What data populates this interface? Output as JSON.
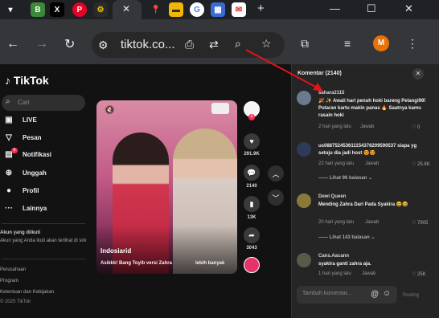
{
  "browser": {
    "url": "tiktok.co...",
    "profile_initial": "M",
    "tab_icons": [
      "B",
      "X",
      "P",
      "gear-icon",
      "maps-icon",
      "card-icon",
      "G",
      "calendar-icon",
      "gmail-icon"
    ],
    "new_tab": "+",
    "window_controls": [
      "—",
      "☐",
      "✕"
    ]
  },
  "tiktok": {
    "logo": "TikTok",
    "search_placeholder": "Cari",
    "nav": [
      {
        "label": "LIVE",
        "icon": "live-icon"
      },
      {
        "label": "Pesan",
        "icon": "messages-icon"
      },
      {
        "label": "Notifikasi",
        "icon": "notifications-icon",
        "badge": "6"
      },
      {
        "label": "Unggah",
        "icon": "upload-icon"
      },
      {
        "label": "Profil",
        "icon": "profile-icon"
      },
      {
        "label": "Lainnya",
        "icon": "more-icon"
      }
    ],
    "following_heading": "Akun yang diikuti",
    "following_note": "Akun yang Anda ikuti akan terlihat di sini",
    "footer_links": [
      "Perusahaan",
      "Program",
      "Ketentuan dan Kebijakan"
    ],
    "copyright": "© 2025 TikTok"
  },
  "video": {
    "author": "Indosiarid",
    "caption": "Asikkk! Bang Toyib versi Zahra",
    "more": "lebih banyak",
    "likes": "291.9K",
    "comments": "2140",
    "saves": "13K",
    "shares": "3043"
  },
  "comments_panel": {
    "title": "Komentar (2140)",
    "input_placeholder": "Tambah komentar...",
    "post_label": "Posting",
    "items": [
      {
        "user": "sahara2115",
        "text": "🎉 ✨ Awali hari penuh hoki bareng Pelangi99! Putaran kartu makin panas 🔥 Saatnya kamu rasain hoki",
        "time": "2 hari yang lalu",
        "reply": "Jawab",
        "likes": "0",
        "avatar_color": "#6b7a8f"
      },
      {
        "user": "",
        "text": "us088752453611154376209590537 siapa yg setuju dia jadi host 😍😍",
        "time": "22 hari yang lalu",
        "reply": "Jawab",
        "likes": "25.8K",
        "replies": "Lihat 96 balasan",
        "avatar_color": "#2f3a5a"
      },
      {
        "user": "Dewi Queen",
        "text": "Mending Zahra Dari Pada Syakira 😆😆",
        "time": "20 hari yang lalu",
        "reply": "Jawab",
        "likes": "7905",
        "replies": "Lihat 143 balasan",
        "avatar_color": "#8a7a3a"
      },
      {
        "user": "Cans.Aacann",
        "text": "syakira ganti zahra aja.",
        "time": "1 hari yang lalu",
        "reply": "Jawab",
        "likes": "25K",
        "avatar_color": "#5a5a4a"
      }
    ]
  }
}
